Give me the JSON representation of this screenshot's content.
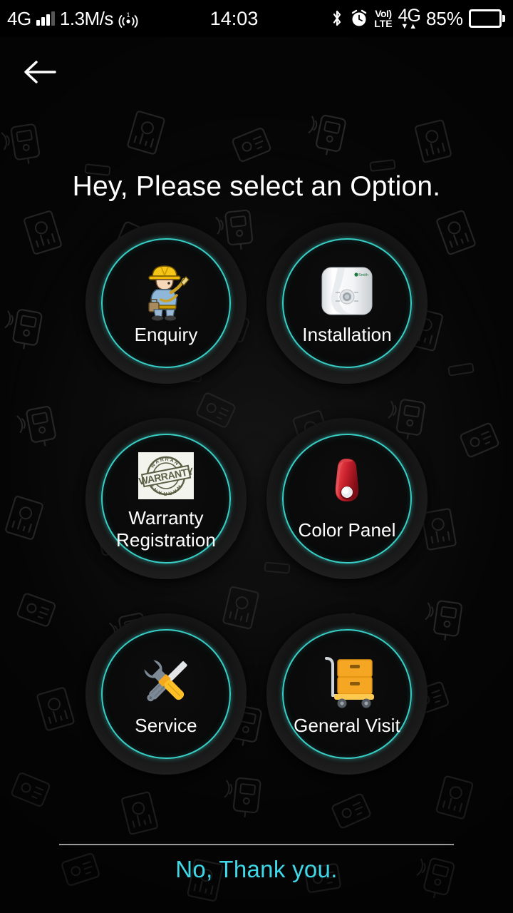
{
  "statusbar": {
    "network_type": "4G",
    "data_speed": "1.3M/s",
    "hotspot_count": "1",
    "time": "14:03",
    "volte_line1": "VoI)",
    "volte_line2": "LTE",
    "network_right": "4G",
    "battery_percent": "85%",
    "icons": {
      "signal": "signal-bars-icon",
      "hotspot": "hotspot-icon",
      "bluetooth": "bluetooth-icon",
      "alarm": "alarm-clock-icon",
      "battery": "battery-icon"
    }
  },
  "navigation": {
    "back_label": "back-arrow"
  },
  "main": {
    "title": "Hey, Please select an Option.",
    "options": [
      {
        "label": "Enquiry",
        "icon": "engineer-worker-icon"
      },
      {
        "label": "Installation",
        "icon": "water-heater-icon"
      },
      {
        "label": "Warranty\nRegistration",
        "icon": "warranty-stamp-icon"
      },
      {
        "label": "Color Panel",
        "icon": "red-color-panel-icon"
      },
      {
        "label": "Service",
        "icon": "wrench-screwdriver-icon"
      },
      {
        "label": "General Visit",
        "icon": "hand-truck-icon"
      }
    ]
  },
  "footer": {
    "decline_label": "No, Thank you."
  },
  "colors": {
    "accent_ring": "#37cfc6",
    "footer_link": "#3fd8e8",
    "background": "#060606",
    "text": "#ffffff",
    "divider": "#9a9a9a"
  }
}
